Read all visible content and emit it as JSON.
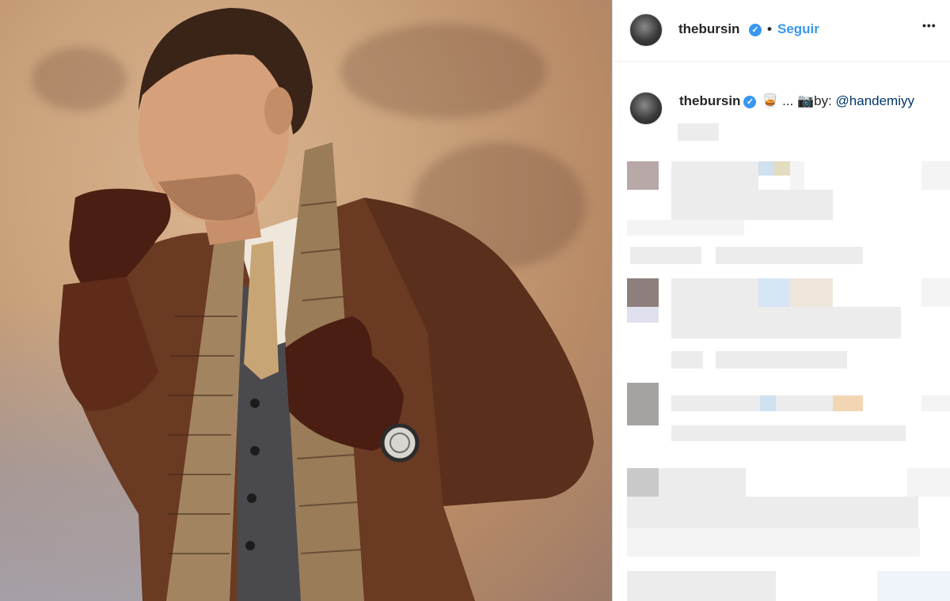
{
  "post": {
    "photo_alt_icon": "photo",
    "author": {
      "username": "thebursin",
      "verified_icon": "verified-check-icon",
      "follow_label": "Seguir",
      "separator": "•",
      "more_label": "•••"
    },
    "caption": {
      "username": "thebursin",
      "text_before": " 🥃 ... 📷by: ",
      "mention": "@handemiyy"
    }
  },
  "colors": {
    "accent": "#3897f0",
    "text": "#262626",
    "border": "#dbdbdb"
  }
}
